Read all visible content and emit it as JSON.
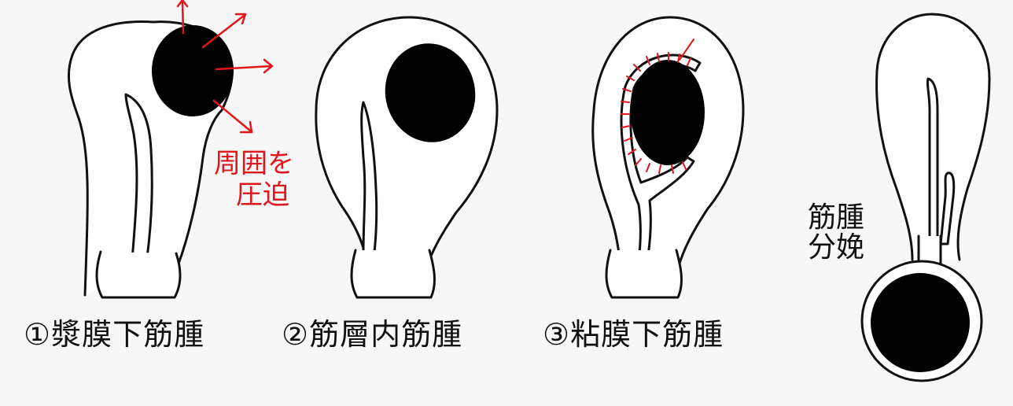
{
  "colors": {
    "background": "#f7f7f7",
    "outline": "#111111",
    "tumor": "#000000",
    "annotation": "#e0161b"
  },
  "figures": [
    {
      "label": "①漿膜下筋腫"
    },
    {
      "label": "②筋層内筋腫"
    },
    {
      "label": "③粘膜下筋腫"
    },
    {
      "label_line1": "筋腫",
      "label_line2": "分娩"
    }
  ],
  "annotation": {
    "line1": "周囲を",
    "line2": "圧迫"
  }
}
